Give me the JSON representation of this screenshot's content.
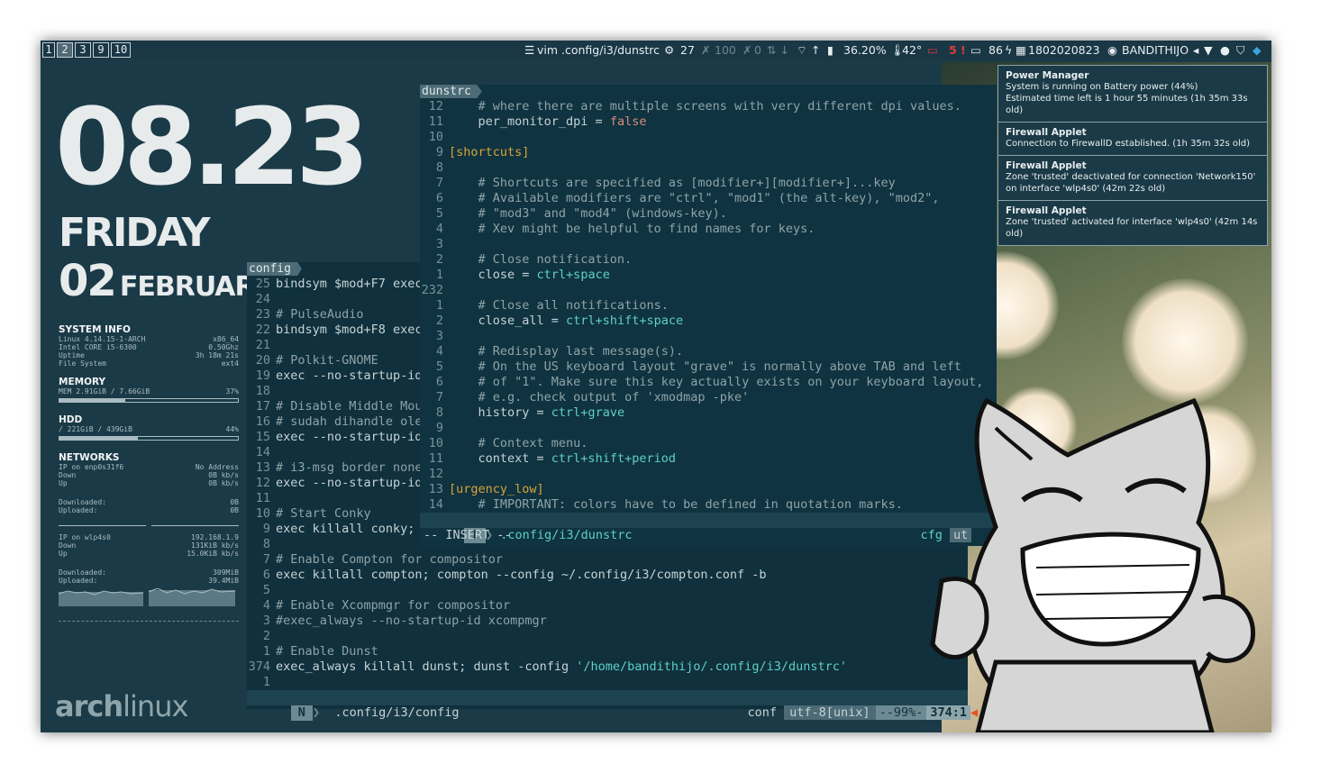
{
  "topbar": {
    "workspaces": [
      "1",
      "2",
      "3",
      "9",
      "10"
    ],
    "active_workspace": "2",
    "window_title": "vim .config/i3/dunstrc",
    "updates": "27",
    "brightness": "100",
    "volume": "0",
    "battery": "36.20%",
    "temperature": "42°",
    "alerts": "5 !",
    "power": "86",
    "datetime": "1802020823",
    "user": "BANDITHIJO"
  },
  "conky": {
    "time": "08.23",
    "day": "FRIDAY",
    "date_num": "02",
    "month": "FEBRUARY",
    "system_info_title": "SYSTEM INFO",
    "system_info": [
      {
        "k": "Linux 4.14.15-1-ARCH",
        "v": "x86_64"
      },
      {
        "k": "Intel CORE i5-6300",
        "v": "0.50Ghz"
      },
      {
        "k": "Uptime",
        "v": "3h 18m 21s"
      },
      {
        "k": "File System",
        "v": "ext4"
      }
    ],
    "memory_title": "MEMORY",
    "memory": {
      "k": "MEM 2.91GiB / 7.66GiB",
      "v": "37%"
    },
    "memory_percent": 0.37,
    "hdd_title": "HDD",
    "hdd": {
      "k": "/  221GiB /  439GiB",
      "v": "44%"
    },
    "hdd_percent": 0.44,
    "networks_title": "NETWORKS",
    "net1": [
      {
        "k": "IP on enp0s31f6",
        "v": "No Address"
      },
      {
        "k": "Down",
        "v": "0B   kb/s"
      },
      {
        "k": "Up",
        "v": "0B   kb/s"
      }
    ],
    "net1_totals": [
      {
        "k": "Downloaded:",
        "v": "0B"
      },
      {
        "k": "Uploaded:",
        "v": "0B"
      }
    ],
    "net2": [
      {
        "k": "IP on wlp4s0",
        "v": "192.168.1.9"
      },
      {
        "k": "Down",
        "v": "131KiB kb/s"
      },
      {
        "k": "Up",
        "v": "15.0KiB kb/s"
      }
    ],
    "net2_totals": [
      {
        "k": "Downloaded:",
        "v": "309MiB"
      },
      {
        "k": "Uploaded:",
        "v": "39.4MiB"
      }
    ],
    "logo_arch": "arch",
    "logo_linux": "linux"
  },
  "config_win": {
    "tab": "config",
    "lines": [
      {
        "n": "25",
        "t": "bindsym $mod+F7 exec"
      },
      {
        "n": "24",
        "t": ""
      },
      {
        "n": "23",
        "t": "# PulseAudio",
        "c": 1
      },
      {
        "n": "22",
        "t": "bindsym $mod+F8 exec"
      },
      {
        "n": "21",
        "t": ""
      },
      {
        "n": "20",
        "t": "# Polkit-GNOME",
        "c": 1
      },
      {
        "n": "19",
        "t": "exec --no-startup-id"
      },
      {
        "n": "18",
        "t": ""
      },
      {
        "n": "17",
        "t": "# Disable Middle Mou",
        "c": 1
      },
      {
        "n": "16",
        "t": "# sudah dihandle ole",
        "c": 1
      },
      {
        "n": "15",
        "t": "exec --no-startup-id"
      },
      {
        "n": "14",
        "t": ""
      },
      {
        "n": "13",
        "t": "# i3-msg border none",
        "c": 1
      },
      {
        "n": "12",
        "t": "exec --no-startup-id"
      },
      {
        "n": "11",
        "t": ""
      },
      {
        "n": "10",
        "t": "# Start Conky",
        "c": 1
      },
      {
        "n": "9",
        "t": "exec killall conky;"
      },
      {
        "n": "8",
        "t": ""
      },
      {
        "n": "7",
        "t": "# Enable Compton for compositor",
        "c": 1
      },
      {
        "n": "6",
        "t": "exec killall compton; compton --config ~/.config/i3/compton.conf -b"
      },
      {
        "n": "5",
        "t": ""
      },
      {
        "n": "4",
        "t": "# Enable Xcompmgr for compositor",
        "c": 1
      },
      {
        "n": "3",
        "t": "#exec_always --no-startup-id xcompmgr",
        "c": 1
      },
      {
        "n": "2",
        "t": ""
      },
      {
        "n": "1",
        "t": "# Enable Dunst",
        "c": 1
      },
      {
        "n": "374",
        "t": "exec_always killall dunst; dunst -config ",
        "s": "'/home/bandithijo/.config/i3/dunstrc'"
      },
      {
        "n": "1",
        "t": ""
      }
    ],
    "status_mode": "N",
    "status_file": ".config/i3/config",
    "status_ft": "conf",
    "status_enc": "utf-8[unix]",
    "status_pct": "--99%-",
    "status_pos": "374:1"
  },
  "dunst_win": {
    "tab": "dunstrc",
    "lines": [
      {
        "n": "12",
        "t": "    # where there are multiple screens with very different dpi values.",
        "c": 1
      },
      {
        "n": "11",
        "t": "    per_monitor_dpi = ",
        "v": "false",
        "vc": "fls"
      },
      {
        "n": "10",
        "t": ""
      },
      {
        "n": "9",
        "t": "[shortcuts]",
        "h": 1
      },
      {
        "n": "8",
        "t": ""
      },
      {
        "n": "7",
        "t": "    # Shortcuts are specified as [modifier+][modifier+]...key",
        "c": 1
      },
      {
        "n": "6",
        "t": "    # Available modifiers are \"ctrl\", \"mod1\" (the alt-key), \"mod2\",",
        "c": 1
      },
      {
        "n": "5",
        "t": "    # \"mod3\" and \"mod4\" (windows-key).",
        "c": 1
      },
      {
        "n": "4",
        "t": "    # Xev might be helpful to find names for keys.",
        "c": 1
      },
      {
        "n": "3",
        "t": ""
      },
      {
        "n": "2",
        "t": "    # Close notification.",
        "c": 1
      },
      {
        "n": "1",
        "t": "    close = ",
        "v": "ctrl+space",
        "vc": "val"
      },
      {
        "n": "232",
        "t": ""
      },
      {
        "n": "1",
        "t": "    # Close all notifications.",
        "c": 1
      },
      {
        "n": "2",
        "t": "    close_all = ",
        "v": "ctrl+shift+space",
        "vc": "val"
      },
      {
        "n": "3",
        "t": ""
      },
      {
        "n": "4",
        "t": "    # Redisplay last message(s).",
        "c": 1
      },
      {
        "n": "5",
        "t": "    # On the US keyboard layout \"grave\" is normally above TAB and left",
        "c": 1
      },
      {
        "n": "6",
        "t": "    # of \"1\". Make sure this key actually exists on your keyboard layout,",
        "c": 1
      },
      {
        "n": "7",
        "t": "    # e.g. check output of 'xmodmap -pke'",
        "c": 1
      },
      {
        "n": "8",
        "t": "    history = ",
        "v": "ctrl+grave",
        "vc": "val"
      },
      {
        "n": "9",
        "t": ""
      },
      {
        "n": "10",
        "t": "    # Context menu.",
        "c": 1
      },
      {
        "n": "11",
        "t": "    context = ",
        "v": "ctrl+shift+period",
        "vc": "val"
      },
      {
        "n": "12",
        "t": ""
      },
      {
        "n": "13",
        "t": "[urgency_low]",
        "h": 1
      },
      {
        "n": "14",
        "t": "    # IMPORTANT: colors have to be defined in quotation marks.",
        "c": 1
      }
    ],
    "status_mode": "I",
    "status_file": ".config/i3/dunstrc",
    "status_ft": "cfg",
    "status_enc": "ut",
    "insert_line": "-- INSERT --"
  },
  "notifications": [
    {
      "title": "Power Manager",
      "body": "System is running on Battery power (44%)\nEstimated time left is 1 hour 55 minutes (1h 35m 33s old)"
    },
    {
      "title": "Firewall Applet",
      "body": "Connection to FirewallD established. (1h 35m 32s old)"
    },
    {
      "title": "Firewall Applet",
      "body": "Zone 'trusted' deactivated for connection 'Network150' on interface 'wlp4s0' (42m 22s old)"
    },
    {
      "title": "Firewall Applet",
      "body": "Zone 'trusted' activated for interface 'wlp4s0' (42m 14s old)"
    }
  ]
}
